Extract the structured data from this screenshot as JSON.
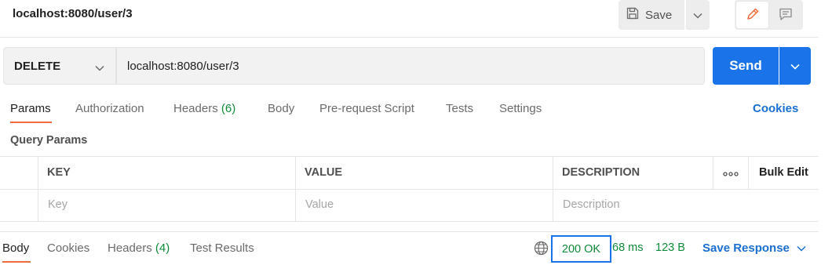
{
  "header": {
    "title": "localhost:8080/user/3",
    "save_label": "Save"
  },
  "request": {
    "method": "DELETE",
    "url": "localhost:8080/user/3",
    "send_label": "Send"
  },
  "request_tabs": {
    "params": "Params",
    "authorization": "Authorization",
    "headers": "Headers",
    "headers_count": "(6)",
    "body": "Body",
    "pre_request": "Pre-request Script",
    "tests": "Tests",
    "settings": "Settings",
    "cookies": "Cookies"
  },
  "query_params": {
    "title": "Query Params",
    "columns": [
      "KEY",
      "VALUE",
      "DESCRIPTION"
    ],
    "bulk_edit": "Bulk Edit",
    "placeholders": [
      "Key",
      "Value",
      "Description"
    ]
  },
  "response": {
    "tabs": {
      "body": "Body",
      "cookies": "Cookies",
      "headers": "Headers",
      "headers_count": "(4)",
      "test_results": "Test Results"
    },
    "status": "200 OK",
    "time": "68 ms",
    "size": "123 B",
    "save_response": "Save Response"
  },
  "colors": {
    "accent": "#1a73e8",
    "tab_underline": "#f26b3a",
    "success": "#0f8a3a"
  },
  "icons": [
    "save-icon",
    "chevron-down-icon",
    "pencil-icon",
    "comment-icon",
    "more-icon",
    "globe-icon"
  ]
}
